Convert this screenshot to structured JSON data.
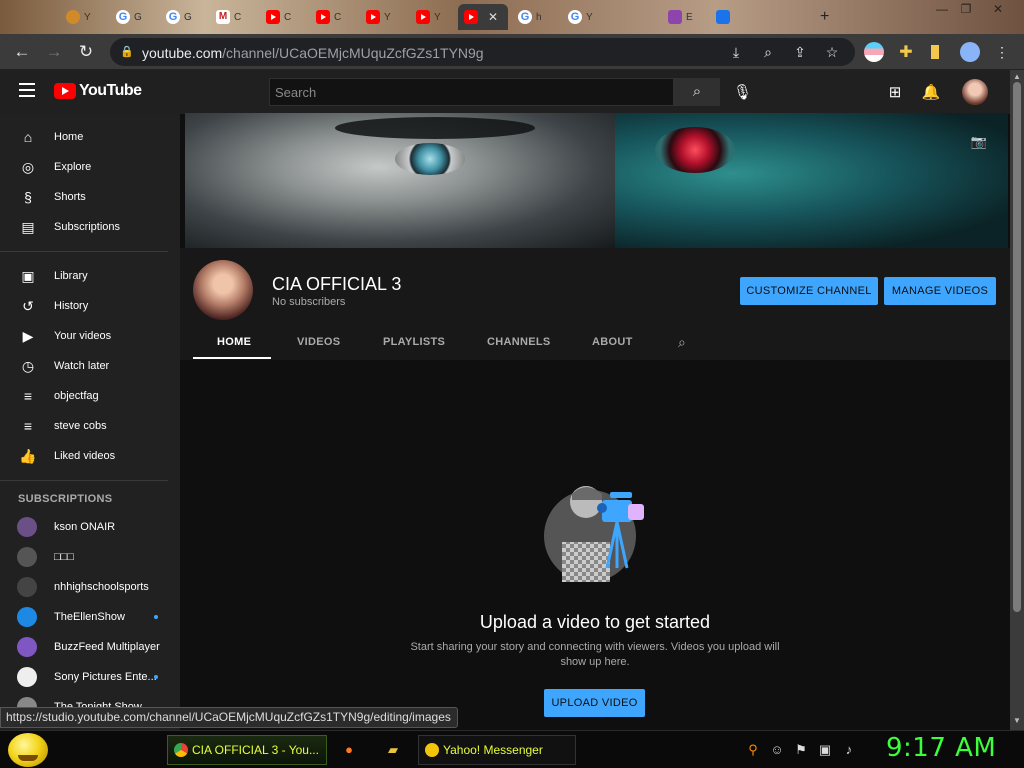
{
  "browser": {
    "tabs": [
      {
        "favicon": "circle-favicon",
        "label": "Y"
      },
      {
        "favicon": "google-favicon",
        "label": "G"
      },
      {
        "favicon": "google-favicon",
        "label": "G"
      },
      {
        "favicon": "gmail-favicon",
        "label": "C"
      },
      {
        "favicon": "youtube-favicon",
        "label": "C"
      },
      {
        "favicon": "youtube-favicon",
        "label": "C"
      },
      {
        "favicon": "youtube-favicon",
        "label": "Y"
      },
      {
        "favicon": "youtube-favicon",
        "label": "Y"
      },
      {
        "favicon": "youtube-favicon",
        "label": ""
      },
      {
        "favicon": "google-favicon",
        "label": "h"
      },
      {
        "favicon": "google-favicon",
        "label": "Y"
      },
      {
        "favicon": "purple-favicon",
        "label": "E"
      },
      {
        "favicon": "blue-favicon",
        "label": ""
      }
    ],
    "active_tab_close": "✕",
    "new_tab": "+",
    "url_host": "youtube.com",
    "url_path": "/channel/UCaOEMjcMUquZcfGZs1TYN9g"
  },
  "youtube": {
    "logo": "YouTube",
    "search_placeholder": "Search",
    "sidebar_main": [
      "Home",
      "Explore",
      "Shorts",
      "Subscriptions"
    ],
    "sidebar_library": [
      "Library",
      "History",
      "Your videos",
      "Watch later",
      "objectfag",
      "steve cobs",
      "Liked videos"
    ],
    "subscriptions_heading": "SUBSCRIPTIONS",
    "subscriptions": [
      {
        "name": "kson ONAIR",
        "new": false
      },
      {
        "name": "□□□",
        "new": false
      },
      {
        "name": "nhhighschoolsports",
        "new": false
      },
      {
        "name": "TheEllenShow",
        "new": true
      },
      {
        "name": "BuzzFeed Multiplayer",
        "new": false
      },
      {
        "name": "Sony Pictures Ente...",
        "new": true
      },
      {
        "name": "The Tonight Show",
        "new": false
      }
    ],
    "channel": {
      "name": "CIA OFFICIAL 3",
      "subscribers": "No subscribers",
      "customize_label": "CUSTOMIZE CHANNEL",
      "manage_label": "MANAGE VIDEOS",
      "tabs": [
        "HOME",
        "VIDEOS",
        "PLAYLISTS",
        "CHANNELS",
        "ABOUT"
      ],
      "active_tab": "HOME"
    },
    "empty_state": {
      "title": "Upload a video to get started",
      "description": "Start sharing your story and connecting with viewers. Videos you upload will show up here.",
      "button": "UPLOAD VIDEO"
    },
    "status_url": "https://studio.youtube.com/channel/UCaOEMjcMUquZcfGZs1TYN9g/editing/images"
  },
  "taskbar": {
    "chrome_task": "CIA OFFICIAL 3 - You...",
    "yahoo_task": "Yahoo! Messenger",
    "clock": "9:17 AM"
  }
}
